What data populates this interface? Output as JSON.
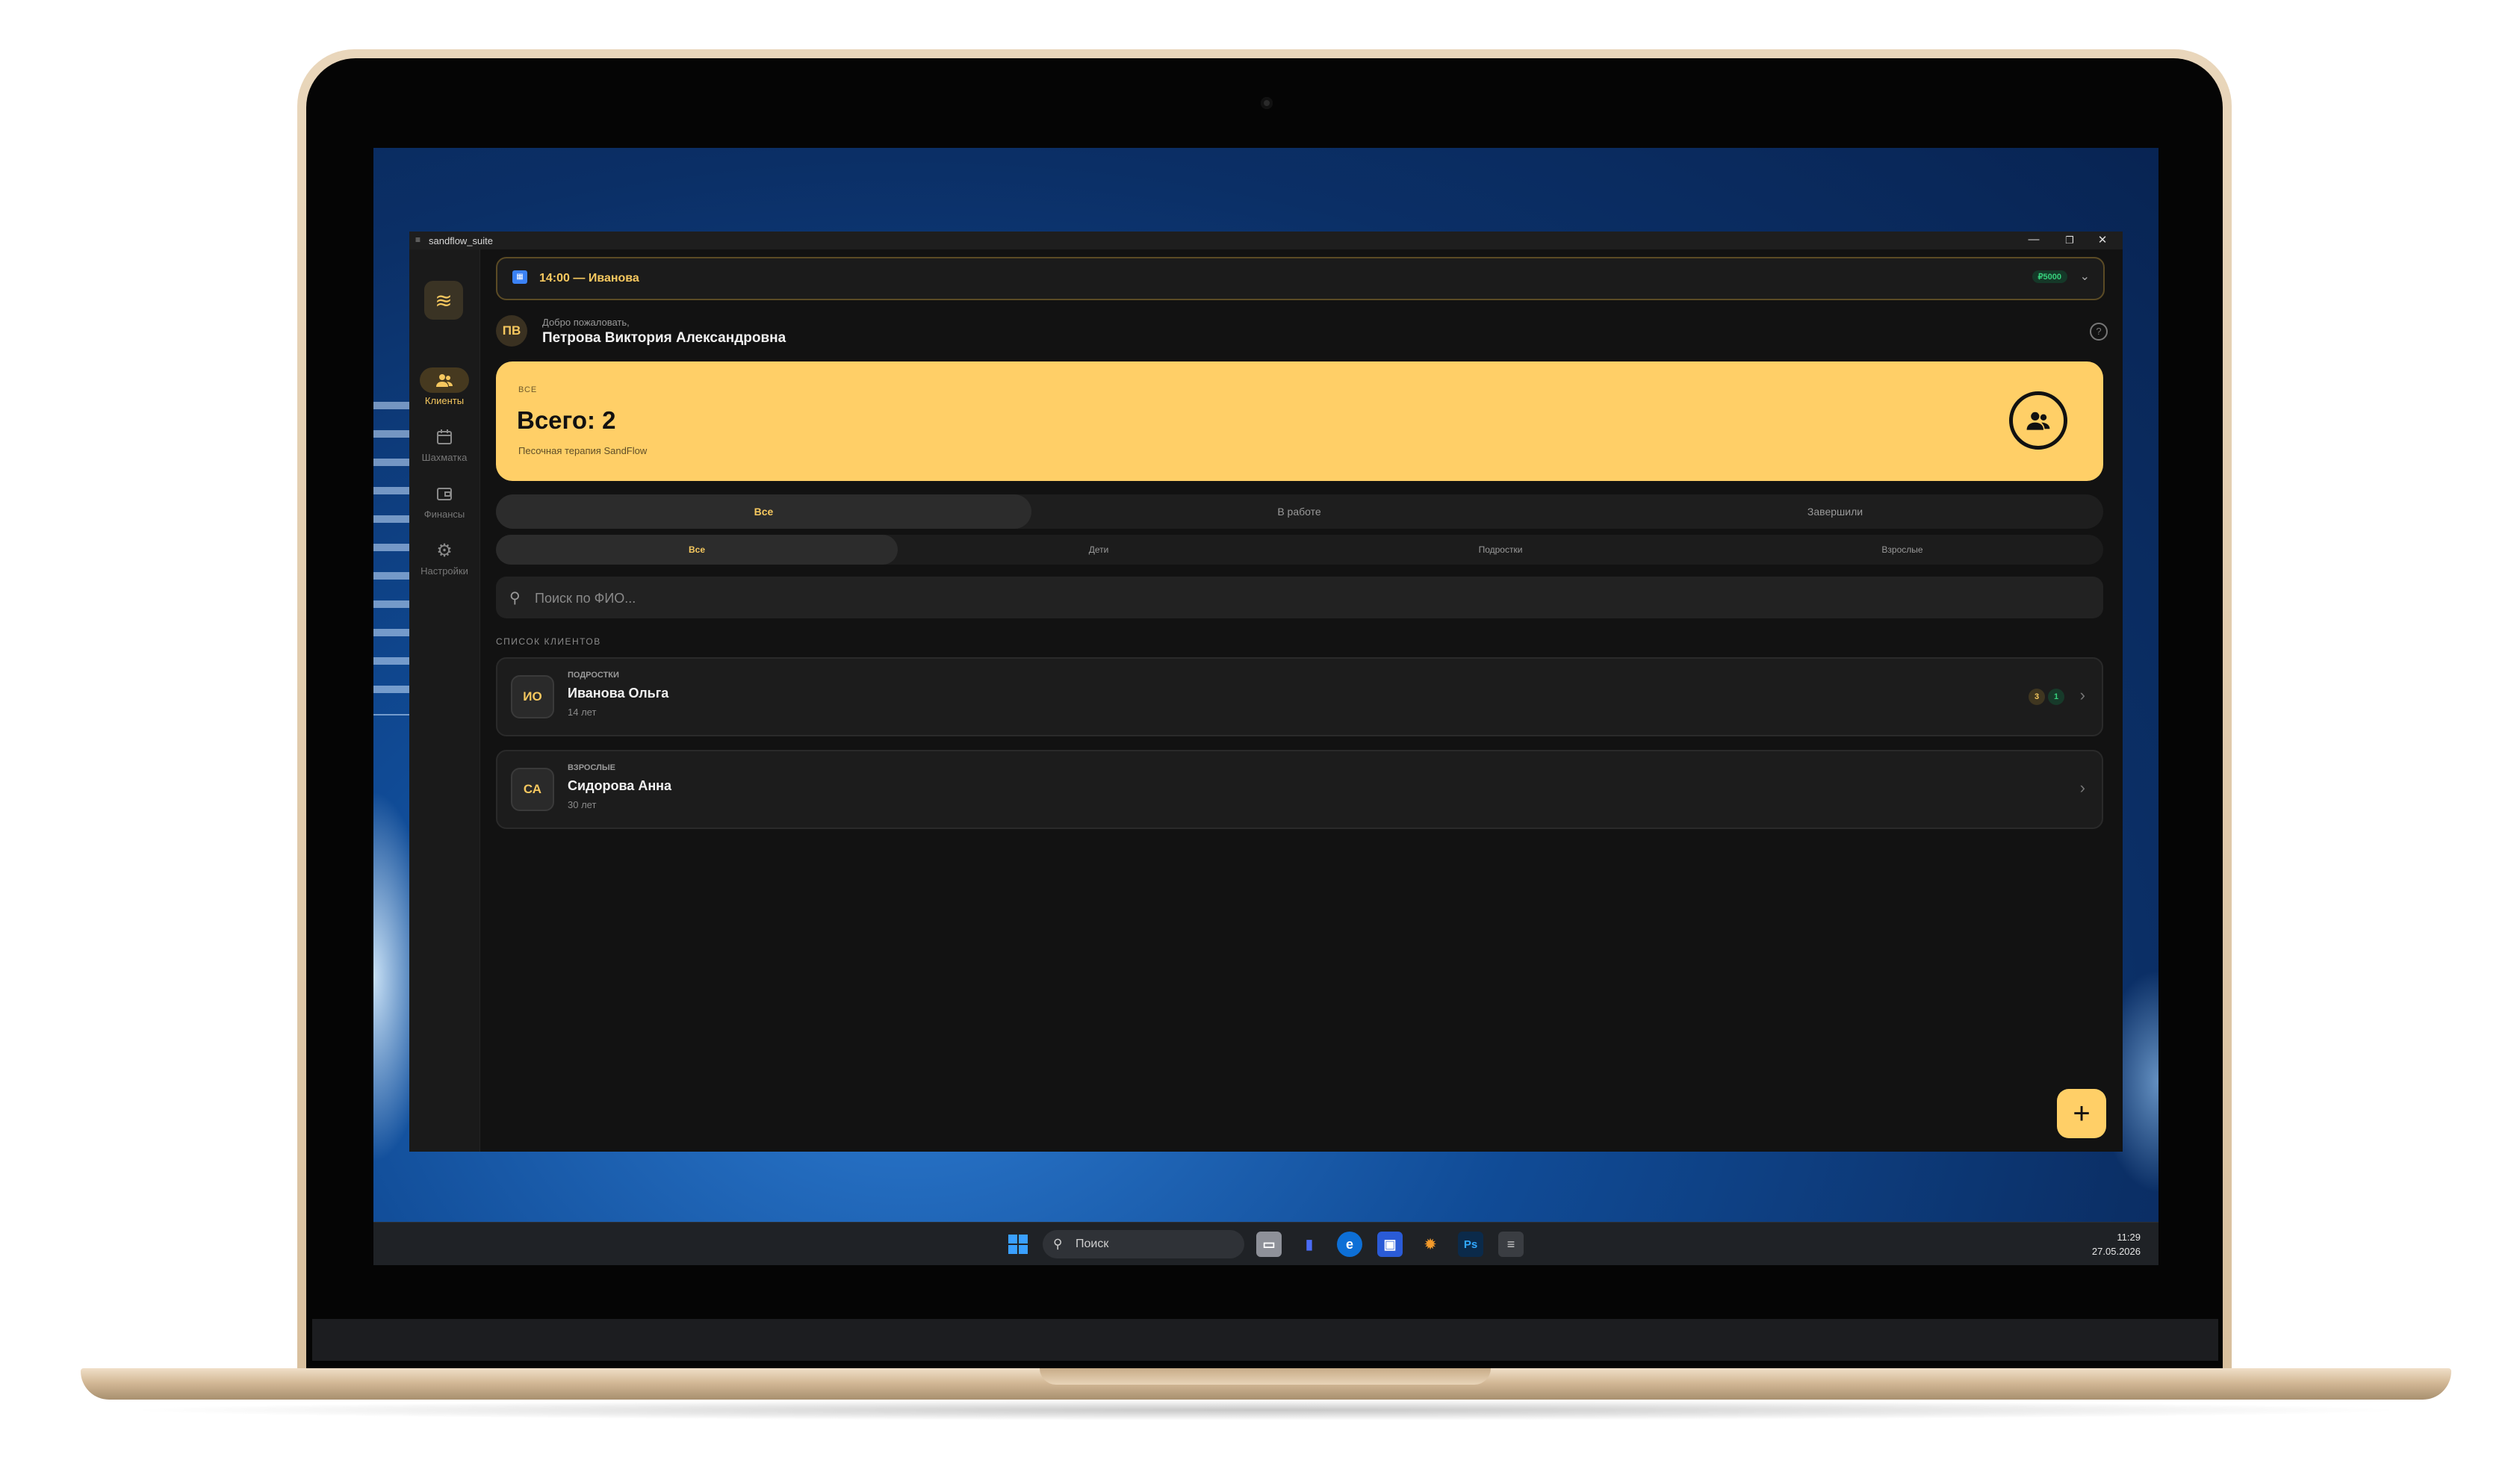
{
  "window": {
    "title": "sandflow_suite",
    "controls": {
      "minimize": "—",
      "maximize": "❐",
      "close": "✕"
    }
  },
  "sidebar": {
    "logo_icon": "waves-icon",
    "items": [
      {
        "label": "Клиенты",
        "icon": "users-icon",
        "active": true
      },
      {
        "label": "Шахматка",
        "icon": "calendar-icon",
        "active": false
      },
      {
        "label": "Финансы",
        "icon": "wallet-icon",
        "active": false
      },
      {
        "label": "Настройки",
        "icon": "gear-icon",
        "active": false
      }
    ]
  },
  "session_bar": {
    "text": "14:00 — Иванова",
    "price": "₽5000"
  },
  "user": {
    "initials": "ПВ",
    "greeting": "Добро пожаловать,",
    "name": "Петрова Виктория Александровна"
  },
  "summary": {
    "category": "Все",
    "total": "Всего: 2",
    "subtitle": "Песочная терапия SandFlow",
    "color": "#ffcf67"
  },
  "status_tabs": [
    {
      "label": "Все",
      "active": true
    },
    {
      "label": "В работе",
      "active": false
    },
    {
      "label": "Завершили",
      "active": false
    }
  ],
  "age_tabs": [
    {
      "label": "Все",
      "active": true
    },
    {
      "label": "Дети",
      "active": false
    },
    {
      "label": "Подростки",
      "active": false
    },
    {
      "label": "Взрослые",
      "active": false
    }
  ],
  "search": {
    "placeholder": "Поиск по ФИО..."
  },
  "clients_section": {
    "title": "Список клиентов"
  },
  "clients": [
    {
      "initials": "ИО",
      "category": "Подростки",
      "name": "Иванова Ольга",
      "age": "14 лет",
      "badges": [
        "3",
        "1"
      ]
    },
    {
      "initials": "СА",
      "category": "Взрослые",
      "name": "Сидорова Анна",
      "age": "30 лет",
      "badges": []
    }
  ],
  "fab": {
    "label": "+"
  },
  "taskbar": {
    "search_label": "Поиск",
    "time": "11:29",
    "date": "27.05.2026"
  },
  "accent_color": "#f6c85f"
}
